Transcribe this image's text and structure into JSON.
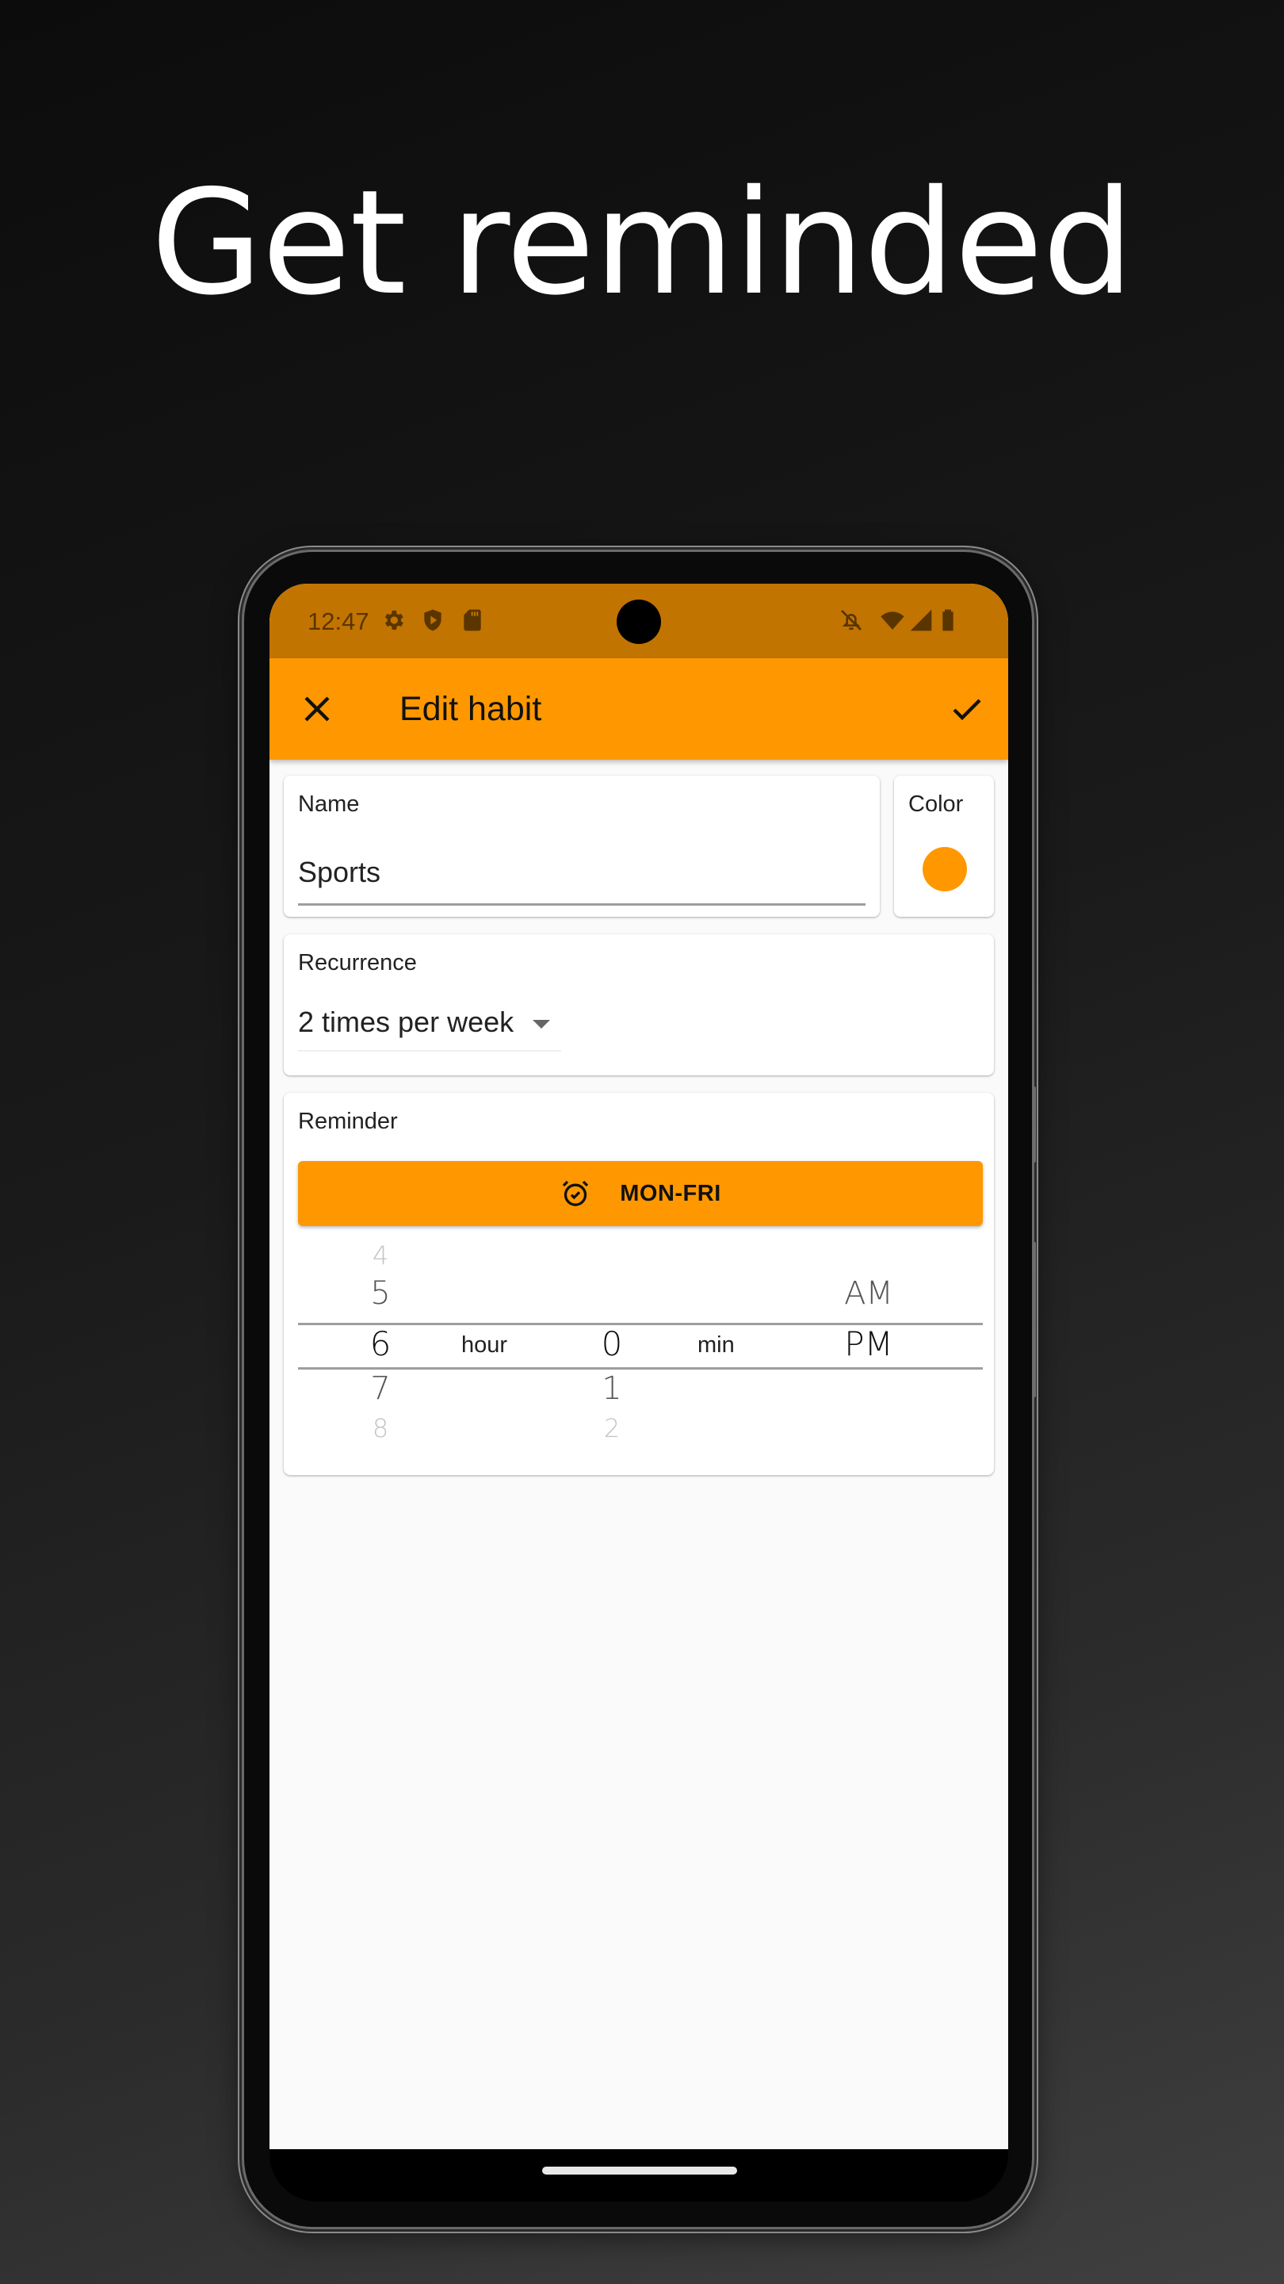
{
  "headline": "Get reminded",
  "status_bar": {
    "time": "12:47",
    "left_icons": [
      "settings-icon",
      "shield-play-icon",
      "sd-card-icon"
    ],
    "right_icons": [
      "bell-off-icon",
      "wifi-icon",
      "signal-icon",
      "battery-icon"
    ]
  },
  "app_bar": {
    "title": "Edit habit",
    "close_icon": "close-icon",
    "save_icon": "check-icon"
  },
  "name_card": {
    "label": "Name",
    "value": "Sports"
  },
  "color_card": {
    "label": "Color",
    "selected_color": "#ff9800"
  },
  "recurrence_card": {
    "label": "Recurrence",
    "selected": "2 times per week"
  },
  "reminder_card": {
    "label": "Reminder",
    "button_label": "MON-FRI",
    "button_icon": "alarm-check-icon",
    "picker": {
      "hours": [
        "4",
        "5",
        "6",
        "7",
        "8"
      ],
      "hour_selected": "6",
      "hour_unit": "hour",
      "minutes": [
        "0",
        "1",
        "2"
      ],
      "minute_selected": "0",
      "minute_unit": "min",
      "periods": [
        "AM",
        "PM"
      ],
      "period_selected": "PM"
    }
  },
  "colors": {
    "accent": "#ff9800",
    "status_bar": "#c27400",
    "background": "#fafafa"
  }
}
